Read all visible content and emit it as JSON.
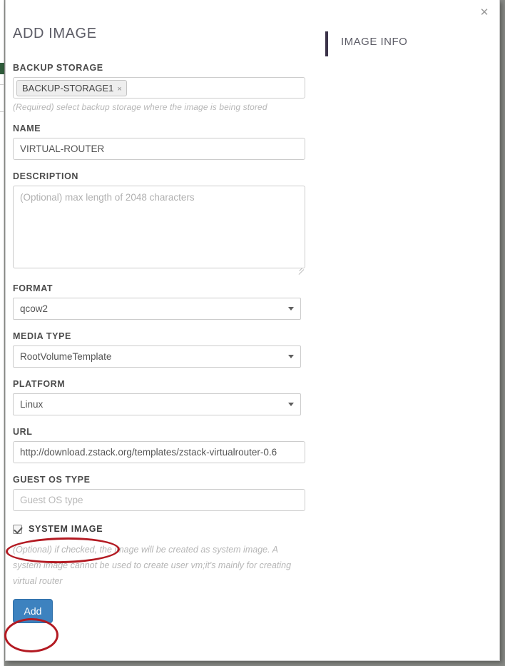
{
  "dialog": {
    "title": "ADD IMAGE",
    "close_label": "✕",
    "close_icon": "close-icon"
  },
  "info_panel": {
    "title": "IMAGE INFO",
    "accent_color": "#3b3349"
  },
  "fields": {
    "backup_storage": {
      "label": "BACKUP STORAGE",
      "tag_value": "BACKUP-STORAGE1",
      "tag_remove": "×",
      "hint": "(Required) select backup storage where the image is being stored"
    },
    "name": {
      "label": "NAME",
      "value": "VIRTUAL-ROUTER",
      "placeholder": ""
    },
    "description": {
      "label": "DESCRIPTION",
      "value": "",
      "placeholder": "(Optional) max length of 2048 characters"
    },
    "format": {
      "label": "FORMAT",
      "value": "qcow2",
      "caret_icon": "chevron-down-icon"
    },
    "media_type": {
      "label": "MEDIA TYPE",
      "value": "RootVolumeTemplate",
      "caret_icon": "chevron-down-icon"
    },
    "platform": {
      "label": "PLATFORM",
      "value": "Linux",
      "caret_icon": "chevron-down-icon"
    },
    "url": {
      "label": "URL",
      "value": "http://download.zstack.org/templates/zstack-virtualrouter-0.6",
      "placeholder": ""
    },
    "guest_os_type": {
      "label": "GUEST OS TYPE",
      "value": "",
      "placeholder": "Guest OS type"
    },
    "system_image": {
      "label": "SYSTEM IMAGE",
      "checked": true,
      "note": "(Optional) if checked, the image will be created as system image. A system image cannot be used to create user vm;it's mainly for creating virtual router"
    }
  },
  "actions": {
    "add_label": "Add",
    "add_color": "#3d82bf"
  },
  "annotations": {
    "color": "#b31a22",
    "shapes": [
      {
        "name": "ellipse-around-system-image-checkbox"
      },
      {
        "name": "ellipse-around-add-button"
      }
    ]
  }
}
